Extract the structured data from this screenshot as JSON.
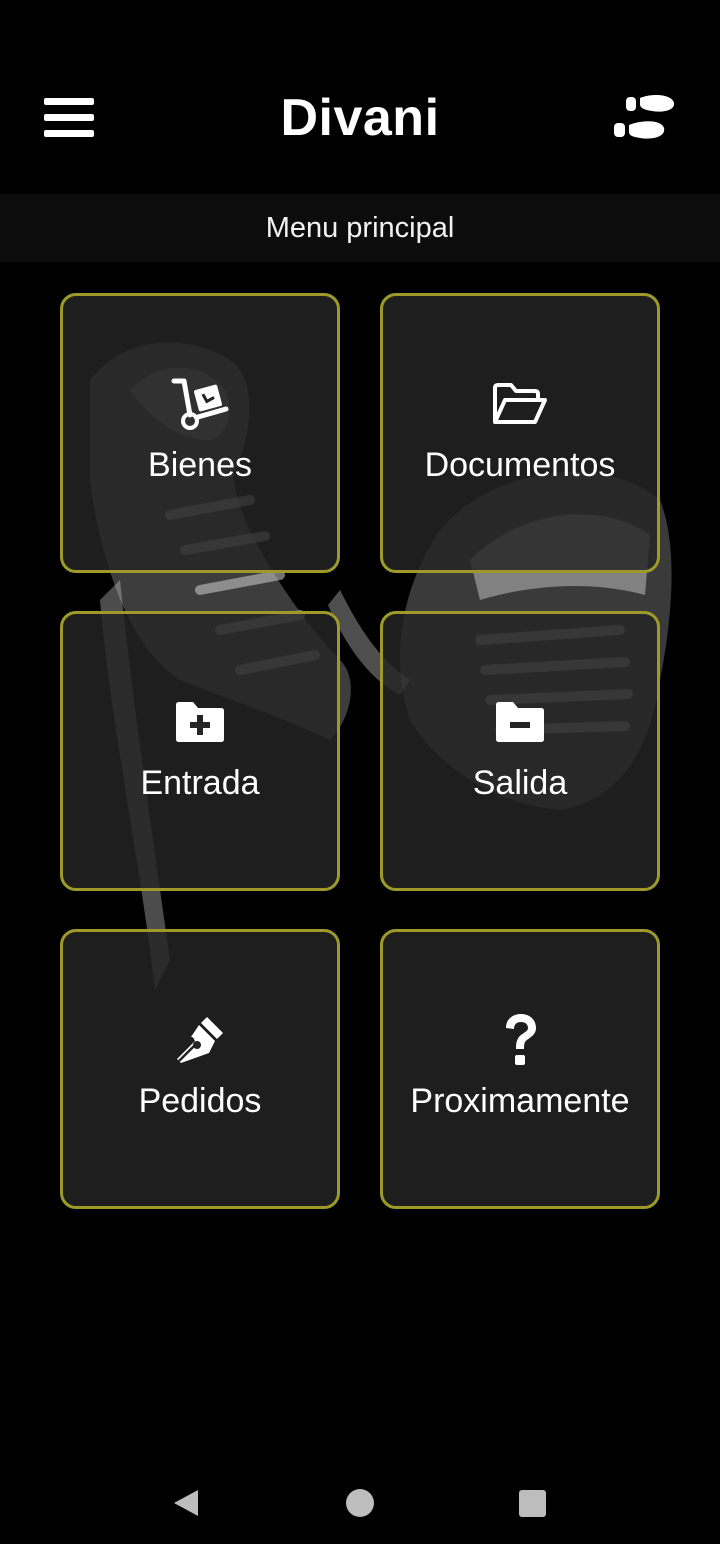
{
  "header": {
    "title": "Divani",
    "menu_icon": "hamburger-menu-icon",
    "logout_icon": "footprints-icon"
  },
  "subheader": {
    "title": "Menu principal"
  },
  "tiles": [
    {
      "label": "Bienes",
      "icon": "dolly-cart-icon"
    },
    {
      "label": "Documentos",
      "icon": "open-folder-icon"
    },
    {
      "label": "Entrada",
      "icon": "folder-plus-icon"
    },
    {
      "label": "Salida",
      "icon": "folder-minus-icon"
    },
    {
      "label": "Pedidos",
      "icon": "fountain-pen-icon"
    },
    {
      "label": "Proximamente",
      "icon": "question-mark-icon"
    }
  ],
  "theme": {
    "background": "#000000",
    "tile_border": "#9e9a2a",
    "tile_fill": "#242424",
    "text": "#ffffff"
  },
  "navbar": {
    "back_icon": "back-triangle-icon",
    "home_icon": "home-circle-icon",
    "recents_icon": "recents-square-icon"
  }
}
